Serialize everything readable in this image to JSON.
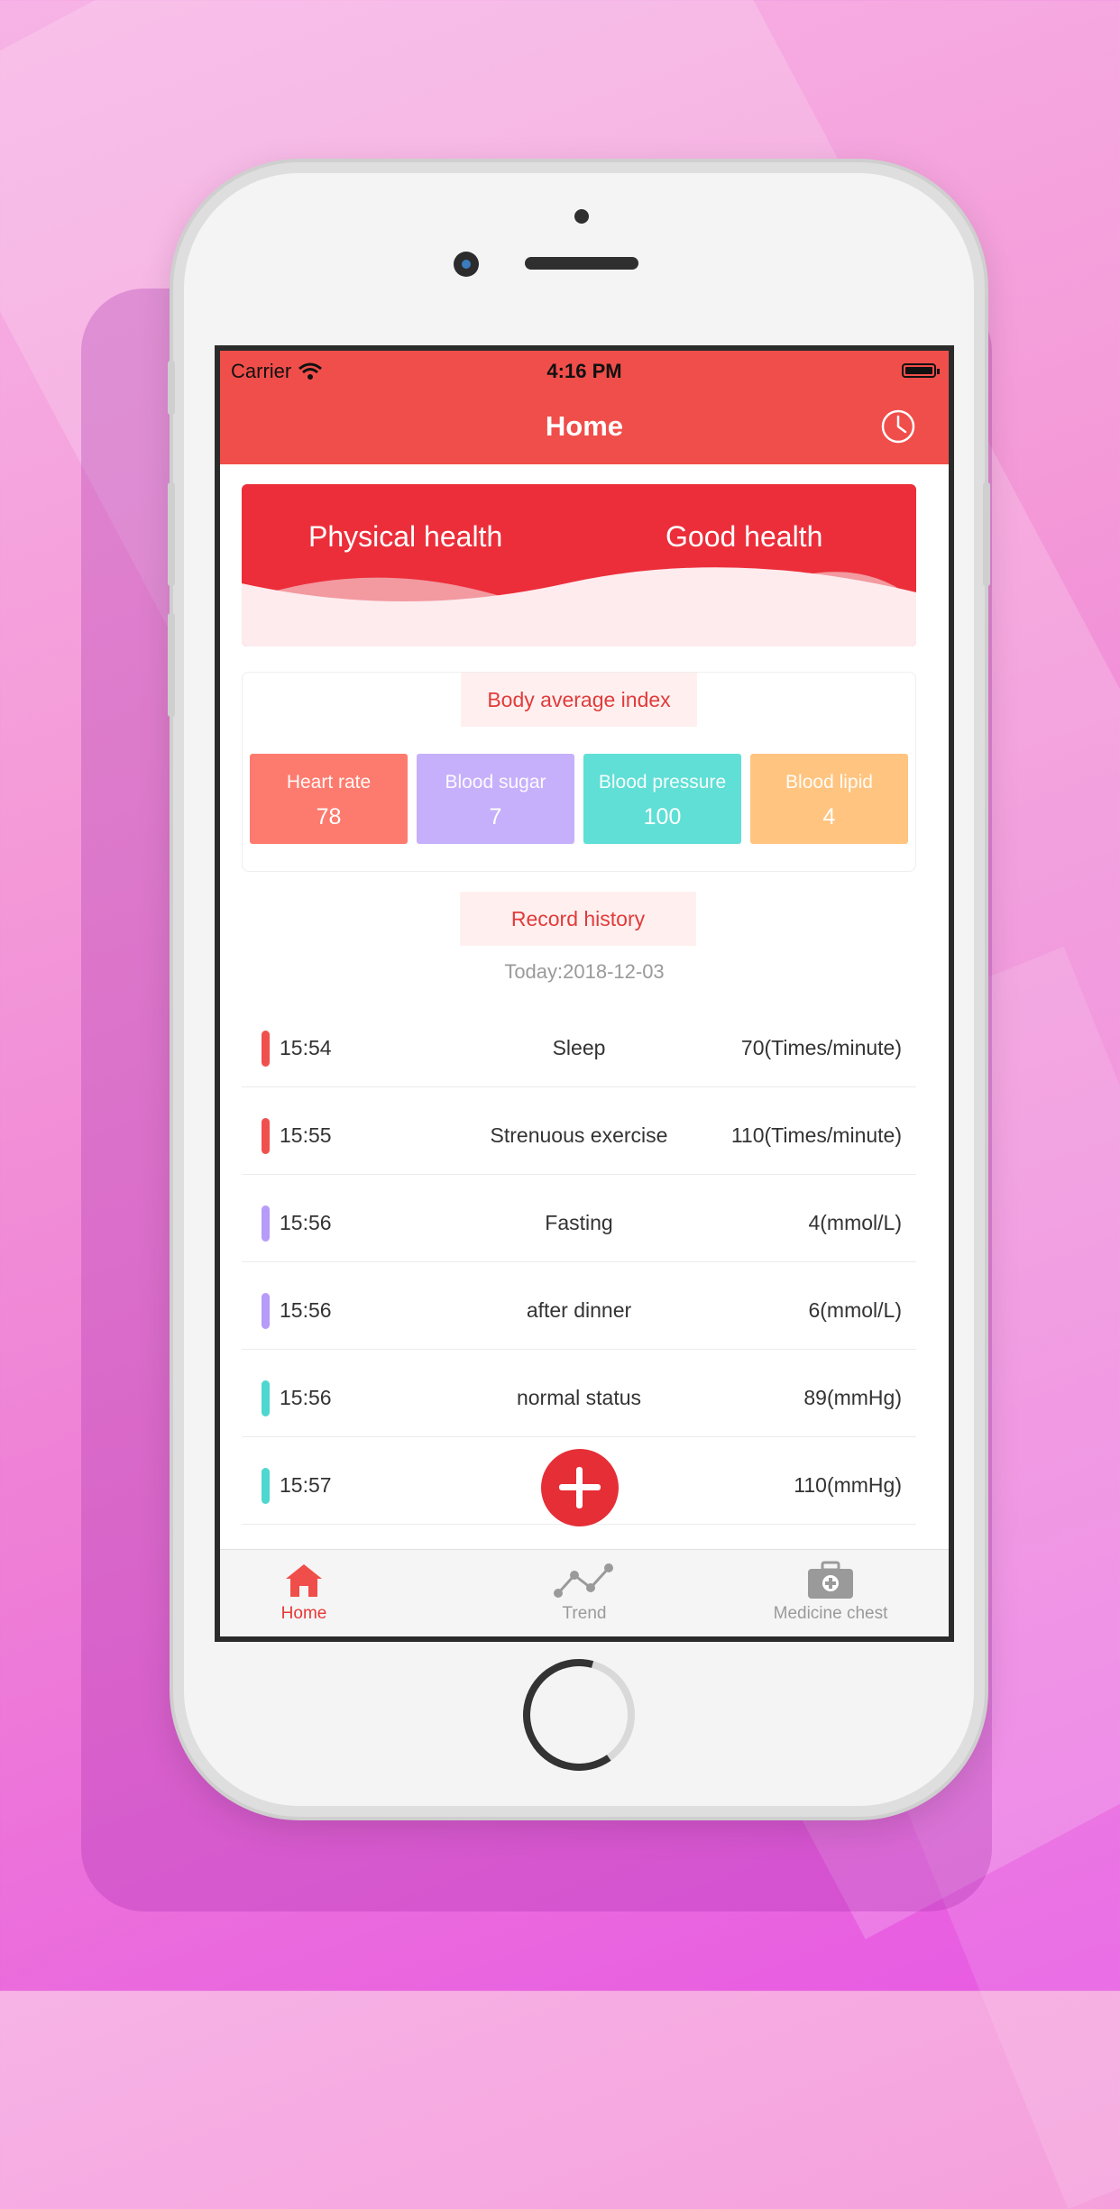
{
  "status_bar": {
    "carrier": "Carrier",
    "time": "4:16 PM"
  },
  "nav": {
    "title": "Home",
    "history_icon": "clock-icon"
  },
  "banner": {
    "left_text": "Physical health",
    "right_text": "Good health"
  },
  "average": {
    "title": "Body average index",
    "tiles": [
      {
        "label": "Heart rate",
        "value": "78",
        "color": "#fd7b6e"
      },
      {
        "label": "Blood sugar",
        "value": "7",
        "color": "#c6b0fb"
      },
      {
        "label": "Blood pressure",
        "value": "100",
        "color": "#5fdfd6"
      },
      {
        "label": "Blood lipid",
        "value": "4",
        "color": "#ffc47f"
      }
    ]
  },
  "history": {
    "title": "Record history",
    "date": "Today:2018-12-03",
    "rows": [
      {
        "time": "15:54",
        "status": "Sleep",
        "value": "70(Times/minute)",
        "color": "#f0504d"
      },
      {
        "time": "15:55",
        "status": "Strenuous exercise",
        "value": "110(Times/minute)",
        "color": "#f0504d"
      },
      {
        "time": "15:56",
        "status": "Fasting",
        "value": "4(mmol/L)",
        "color": "#b79bf9"
      },
      {
        "time": "15:56",
        "status": "after dinner",
        "value": "6(mmol/L)",
        "color": "#b79bf9"
      },
      {
        "time": "15:56",
        "status": "normal status",
        "value": "89(mmHg)",
        "color": "#4dd7cf"
      },
      {
        "time": "15:57",
        "status": "",
        "value": "110(mmHg)",
        "color": "#4dd7cf"
      }
    ]
  },
  "fab": {
    "icon": "plus-icon"
  },
  "tabs": [
    {
      "label": "Home",
      "icon": "home-icon",
      "active": true
    },
    {
      "label": "Trend",
      "icon": "trend-icon",
      "active": false
    },
    {
      "label": "Medicine chest",
      "icon": "medicine-chest-icon",
      "active": false
    }
  ],
  "colors": {
    "primary": "#f04e4a",
    "banner": "#ec2e3a",
    "inactive": "#9a9a9a"
  }
}
